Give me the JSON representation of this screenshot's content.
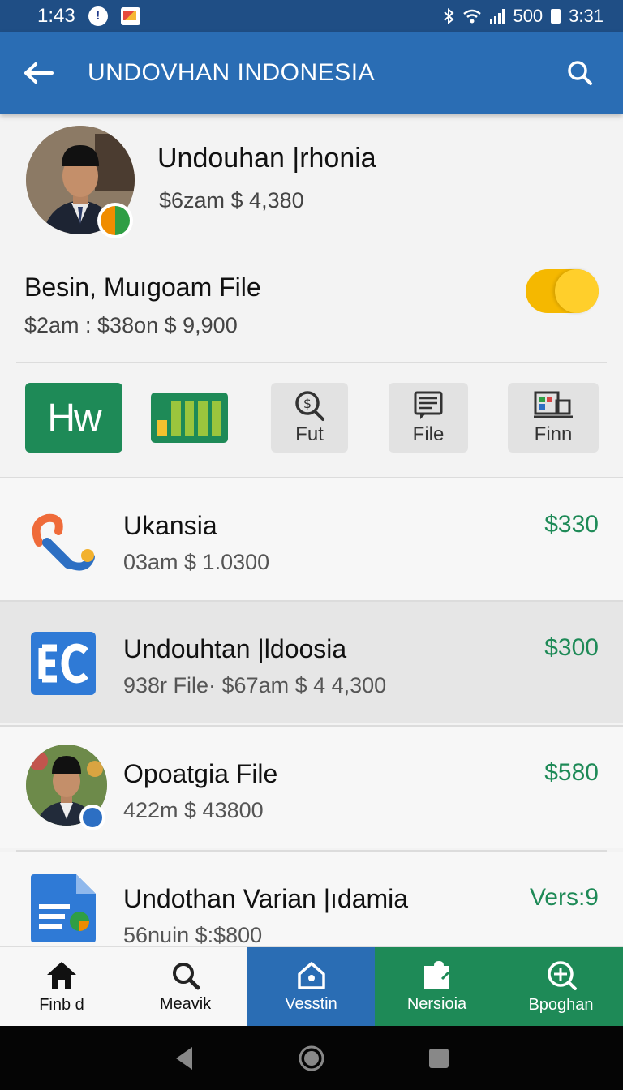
{
  "status_bar": {
    "time_left": "1:43",
    "notif_1": "!",
    "network": "500",
    "time_right": "3:31"
  },
  "app_bar": {
    "title": "UNDOVHAN INDONESIA"
  },
  "profile": {
    "name": "Undouhan |rhonia",
    "subtitle": "$6zam $ 4,380"
  },
  "file_section": {
    "title": "Besin, Muıgoam File",
    "subtitle": "$2am : $38on $ 9,900",
    "toggle_on": true
  },
  "tools": [
    {
      "label": "Hw"
    },
    {
      "label": ""
    },
    {
      "label": "Fut"
    },
    {
      "label": "File"
    },
    {
      "label": "Finn"
    }
  ],
  "list": [
    {
      "title": "Ukansia",
      "subtitle": "03am $ 1.0300",
      "amount": "$330"
    },
    {
      "title": "Undouhtan |ldoosia",
      "subtitle": "938r File· $67am $ 4 4,300",
      "amount": "$300"
    },
    {
      "title": "Opoatgia File",
      "subtitle": "422m $ 43800",
      "amount": "$580"
    },
    {
      "title": "Undothan Varian |ıdamia",
      "subtitle": "56nuin $:$800",
      "amount": "Vers:9"
    }
  ],
  "bottom_nav": [
    {
      "label": "Finb d"
    },
    {
      "label": "Meavik"
    },
    {
      "label": "Vesstin"
    },
    {
      "label": "Nersioia"
    },
    {
      "label": "Bpoghan"
    }
  ],
  "colors": {
    "app_bar": "#2a6db4",
    "status_bar": "#1f4e85",
    "accent_green": "#1e8a57",
    "nav_blue": "#2a6db4",
    "toggle": "#f5b800"
  }
}
